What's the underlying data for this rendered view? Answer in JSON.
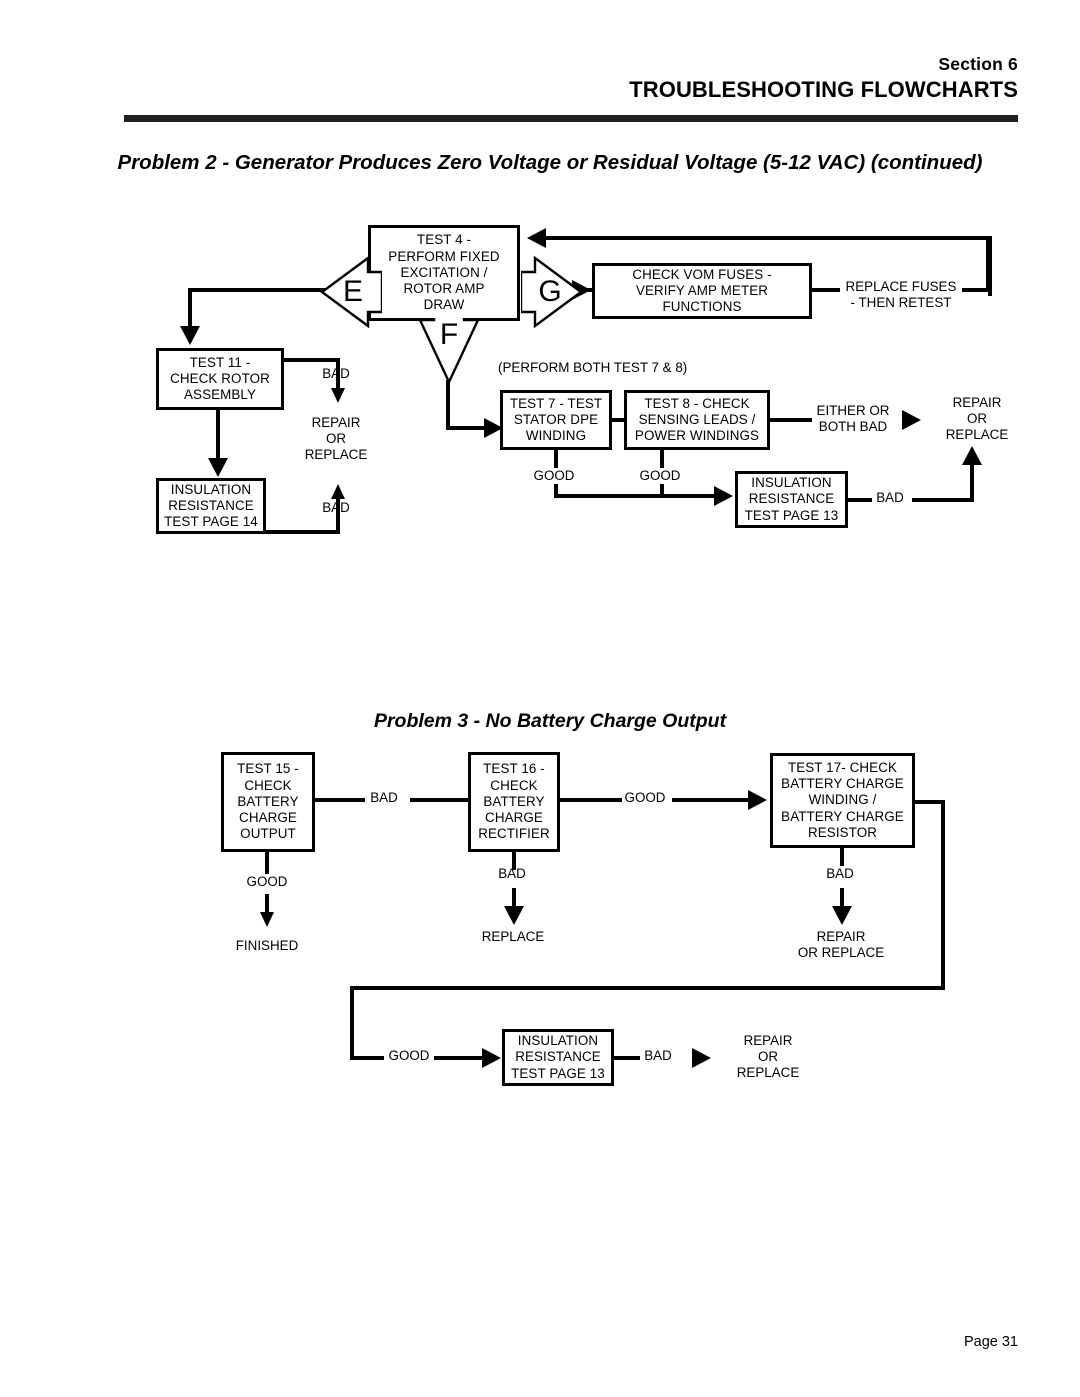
{
  "header": {
    "section": "Section  6",
    "title": "TROUBLESHOOTING FLOWCHARTS"
  },
  "footer": {
    "page": "Page 31"
  },
  "problem2": {
    "title": "Problem 2 -  Generator Produces Zero Voltage or Residual Voltage (5-12 VAC)\n(continued)",
    "nodes": {
      "test4": "TEST 4 -\nPERFORM FIXED\nEXCITATION /\nROTOR AMP\nDRAW",
      "test11": "TEST 11 -\nCHECK ROTOR\nASSEMBLY",
      "insulation14": "INSULATION\nRESISTANCE\nTEST PAGE 14",
      "check_vom": "CHECK VOM FUSES -\nVERIFY AMP METER\nFUNCTIONS",
      "test7": "TEST 7 - TEST\nSTATOR DPE\nWINDING",
      "test8": "TEST 8 - CHECK\nSENSING LEADS /\nPOWER WINDINGS",
      "insulation13": "INSULATION\nRESISTANCE\nTEST PAGE 13"
    },
    "connectors": {
      "e": "E",
      "g": "G",
      "f": "F"
    },
    "labels": {
      "bad_test11": "BAD",
      "repair_or_replace_left": "REPAIR\nOR\nREPLACE",
      "bad_insulation14": "BAD",
      "replace_fuses": "REPLACE FUSES\n- THEN RETEST",
      "perform_both": "(PERFORM BOTH TEST 7 & 8)",
      "good_test7": "GOOD",
      "good_test8": "GOOD",
      "either_or_both_bad": "EITHER OR\nBOTH BAD",
      "repair_or_replace_right": "REPAIR\nOR\nREPLACE",
      "bad_insulation13": "BAD"
    }
  },
  "problem3": {
    "title": "Problem 3 -  No Battery Charge Output",
    "nodes": {
      "test15": "TEST 15 -\nCHECK\nBATTERY\nCHARGE\nOUTPUT",
      "test16": "TEST 16 -\nCHECK\nBATTERY\nCHARGE\nRECTIFIER",
      "test17": "TEST 17- CHECK\nBATTERY CHARGE\nWINDING /\nBATTERY CHARGE\nRESISTOR",
      "insulation13": "INSULATION\nRESISTANCE\nTEST PAGE 13"
    },
    "labels": {
      "bad_15_16": "BAD",
      "good_16_17": "GOOD",
      "good_15": "GOOD",
      "finished": "FINISHED",
      "bad_16": "BAD",
      "replace": "REPLACE",
      "bad_17": "BAD",
      "repair_or_replace_17": "REPAIR\nOR REPLACE",
      "good_loop": "GOOD",
      "bad_insulation": "BAD",
      "repair_or_replace_end": "REPAIR\nOR\nREPLACE"
    }
  }
}
